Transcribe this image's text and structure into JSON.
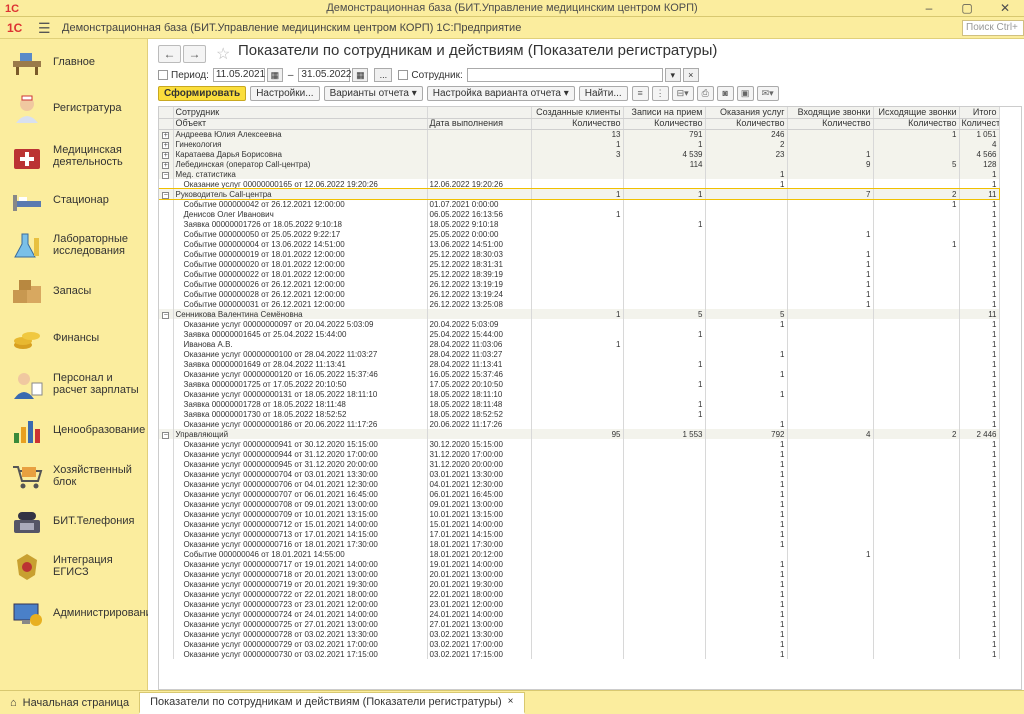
{
  "window": {
    "title": "Демонстрационная база (БИТ.Управление медицинским центром КОРП)",
    "logo": "1С"
  },
  "appbar": {
    "app_title": "Демонстрационная база (БИТ.Управление медицинским центром КОРП)  1С:Предприятие",
    "search_placeholder": "Поиск Ctrl+"
  },
  "sidebar": {
    "items": [
      {
        "label": "Главное",
        "icon": "desk-icon"
      },
      {
        "label": "Регистратура",
        "icon": "nurse-icon"
      },
      {
        "label": "Медицинская деятельность",
        "icon": "medkit-icon"
      },
      {
        "label": "Стационар",
        "icon": "bed-icon"
      },
      {
        "label": "Лабораторные исследования",
        "icon": "lab-icon"
      },
      {
        "label": "Запасы",
        "icon": "boxes-icon"
      },
      {
        "label": "Финансы",
        "icon": "coins-icon"
      },
      {
        "label": "Персонал и расчет зарплаты",
        "icon": "staff-icon"
      },
      {
        "label": "Ценообразование",
        "icon": "chart-icon"
      },
      {
        "label": "Хозяйственный блок",
        "icon": "cart-icon"
      },
      {
        "label": "БИТ.Телефония",
        "icon": "phone-icon"
      },
      {
        "label": "Интеграция ЕГИСЗ",
        "icon": "emblem-icon"
      },
      {
        "label": "Администрирование",
        "icon": "admin-icon"
      }
    ]
  },
  "page": {
    "title": "Показатели по сотрудникам и действиям (Показатели регистратуры)"
  },
  "filters": {
    "period_label": "Период:",
    "date_from": "11.05.2021",
    "dash": "–",
    "date_to": "31.05.2022",
    "ellipsis": "...",
    "employee_label": "Сотрудник:",
    "employee_value": ""
  },
  "toolbar": {
    "generate": "Сформировать",
    "settings": "Настройки...",
    "variants": "Варианты отчета",
    "variant_settings": "Настройка варианта отчета",
    "find": "Найти..."
  },
  "table": {
    "headers1": [
      "Сотрудник",
      "",
      "Созданные клиенты",
      "Записи на прием",
      "Оказания услуг",
      "Входящие звонки",
      "Исходящие звонки",
      "Итого"
    ],
    "headers2": [
      "Объект",
      "Дата выполнения",
      "Количество",
      "Количество",
      "Количество",
      "Количество",
      "Количество",
      "Количество"
    ],
    "rows": [
      {
        "t": "g",
        "c": [
          "Андреева Юлия Алексеевна",
          "",
          "13",
          "791",
          "246",
          "",
          "1",
          "1 051"
        ]
      },
      {
        "t": "g",
        "c": [
          "Гинекология",
          "",
          "1",
          "1",
          "2",
          "",
          "",
          "4"
        ]
      },
      {
        "t": "g",
        "c": [
          "Каратаева Дарья Борисовна",
          "",
          "3",
          "4 539",
          "23",
          "1",
          "",
          "4 566"
        ]
      },
      {
        "t": "g",
        "c": [
          "Лебединская (оператор Call-центра)",
          "",
          "",
          "114",
          "",
          "9",
          "5",
          "128"
        ]
      },
      {
        "t": "g",
        "o": 1,
        "c": [
          "Мед. статистика",
          "",
          "",
          "",
          "1",
          "",
          "",
          "1"
        ]
      },
      {
        "t": "d",
        "c": [
          "Оказание услуг 00000000165 от 12.06.2022 19:20:26",
          "12.06.2022 19:20:26",
          "",
          "",
          "1",
          "",
          "",
          "1"
        ]
      },
      {
        "t": "g",
        "o": 1,
        "s": 1,
        "c": [
          "Руководитель Call-центра",
          "",
          "1",
          "1",
          "",
          "7",
          "2",
          "11"
        ]
      },
      {
        "t": "d",
        "c": [
          "Событие 000000042 от 26.12.2021 12:00:00",
          "01.07.2021 0:00:00",
          "",
          "",
          "",
          "",
          "1",
          "1"
        ]
      },
      {
        "t": "d",
        "c": [
          "Денисов Олег Иванович",
          "06.05.2022 16:13:56",
          "1",
          "",
          "",
          "",
          "",
          "1"
        ]
      },
      {
        "t": "d",
        "c": [
          "Заявка 00000001726 от 18.05.2022 9:10:18",
          "18.05.2022 9:10:18",
          "",
          "1",
          "",
          "",
          "",
          "1"
        ]
      },
      {
        "t": "d",
        "c": [
          "Событие 000000050 от 25.05.2022 9:22:17",
          "25.05.2022 0:00:00",
          "",
          "",
          "",
          "1",
          "",
          "1"
        ]
      },
      {
        "t": "d",
        "c": [
          "Событие 000000004 от 13.06.2022 14:51:00",
          "13.06.2022 14:51:00",
          "",
          "",
          "",
          "",
          "1",
          "1"
        ]
      },
      {
        "t": "d",
        "c": [
          "Событие 000000019 от 18.01.2022 12:00:00",
          "25.12.2022 18:30:03",
          "",
          "",
          "",
          "1",
          "",
          "1"
        ]
      },
      {
        "t": "d",
        "c": [
          "Событие 000000020 от 18.01.2022 12:00:00",
          "25.12.2022 18:31:31",
          "",
          "",
          "",
          "1",
          "",
          "1"
        ]
      },
      {
        "t": "d",
        "c": [
          "Событие 000000022 от 18.01.2022 12:00:00",
          "25.12.2022 18:39:19",
          "",
          "",
          "",
          "1",
          "",
          "1"
        ]
      },
      {
        "t": "d",
        "c": [
          "Событие 000000026 от 26.12.2021 12:00:00",
          "26.12.2022 13:19:19",
          "",
          "",
          "",
          "1",
          "",
          "1"
        ]
      },
      {
        "t": "d",
        "c": [
          "Событие 000000028 от 26.12.2021 12:00:00",
          "26.12.2022 13:19:24",
          "",
          "",
          "",
          "1",
          "",
          "1"
        ]
      },
      {
        "t": "d",
        "c": [
          "Событие 000000031 от 26.12.2021 12:00:00",
          "26.12.2022 13:25:08",
          "",
          "",
          "",
          "1",
          "",
          "1"
        ]
      },
      {
        "t": "g",
        "o": 1,
        "c": [
          "Сенникова Валентина Семёновна",
          "",
          "1",
          "5",
          "5",
          "",
          "",
          "11"
        ]
      },
      {
        "t": "d",
        "c": [
          "Оказание услуг 00000000097 от 20.04.2022 5:03:09",
          "20.04.2022 5:03:09",
          "",
          "",
          "1",
          "",
          "",
          "1"
        ]
      },
      {
        "t": "d",
        "c": [
          "Заявка 00000001645 от 25.04.2022 15:44:00",
          "25.04.2022 15:44:00",
          "",
          "1",
          "",
          "",
          "",
          "1"
        ]
      },
      {
        "t": "d",
        "c": [
          "Иванова А.В.",
          "28.04.2022 11:03:06",
          "1",
          "",
          "",
          "",
          "",
          "1"
        ]
      },
      {
        "t": "d",
        "c": [
          "Оказание услуг 00000000100 от 28.04.2022 11:03:27",
          "28.04.2022 11:03:27",
          "",
          "",
          "1",
          "",
          "",
          "1"
        ]
      },
      {
        "t": "d",
        "c": [
          "Заявка 00000001649 от 28.04.2022 11:13:41",
          "28.04.2022 11:13:41",
          "",
          "1",
          "",
          "",
          "",
          "1"
        ]
      },
      {
        "t": "d",
        "c": [
          "Оказание услуг 00000000120 от 16.05.2022 15:37:46",
          "16.05.2022 15:37:46",
          "",
          "",
          "1",
          "",
          "",
          "1"
        ]
      },
      {
        "t": "d",
        "c": [
          "Заявка 00000001725 от 17.05.2022 20:10:50",
          "17.05.2022 20:10:50",
          "",
          "1",
          "",
          "",
          "",
          "1"
        ]
      },
      {
        "t": "d",
        "c": [
          "Оказание услуг 00000000131 от 18.05.2022 18:11:10",
          "18.05.2022 18:11:10",
          "",
          "",
          "1",
          "",
          "",
          "1"
        ]
      },
      {
        "t": "d",
        "c": [
          "Заявка 00000001728 от 18.05.2022 18:11:48",
          "18.05.2022 18:11:48",
          "",
          "1",
          "",
          "",
          "",
          "1"
        ]
      },
      {
        "t": "d",
        "c": [
          "Заявка 00000001730 от 18.05.2022 18:52:52",
          "18.05.2022 18:52:52",
          "",
          "1",
          "",
          "",
          "",
          "1"
        ]
      },
      {
        "t": "d",
        "c": [
          "Оказание услуг 00000000186 от 20.06.2022 11:17:26",
          "20.06.2022 11:17:26",
          "",
          "",
          "1",
          "",
          "",
          "1"
        ]
      },
      {
        "t": "g",
        "o": 1,
        "c": [
          "Управляющий",
          "",
          "95",
          "1 553",
          "792",
          "4",
          "2",
          "2 446"
        ]
      },
      {
        "t": "d",
        "c": [
          "Оказание услуг 00000000941 от 30.12.2020 15:15:00",
          "30.12.2020 15:15:00",
          "",
          "",
          "1",
          "",
          "",
          "1"
        ]
      },
      {
        "t": "d",
        "c": [
          "Оказание услуг 00000000944 от 31.12.2020 17:00:00",
          "31.12.2020 17:00:00",
          "",
          "",
          "1",
          "",
          "",
          "1"
        ]
      },
      {
        "t": "d",
        "c": [
          "Оказание услуг 00000000945 от 31.12.2020 20:00:00",
          "31.12.2020 20:00:00",
          "",
          "",
          "1",
          "",
          "",
          "1"
        ]
      },
      {
        "t": "d",
        "c": [
          "Оказание услуг 00000000704 от 03.01.2021 13:30:00",
          "03.01.2021 13:30:00",
          "",
          "",
          "1",
          "",
          "",
          "1"
        ]
      },
      {
        "t": "d",
        "c": [
          "Оказание услуг 00000000706 от 04.01.2021 12:30:00",
          "04.01.2021 12:30:00",
          "",
          "",
          "1",
          "",
          "",
          "1"
        ]
      },
      {
        "t": "d",
        "c": [
          "Оказание услуг 00000000707 от 06.01.2021 16:45:00",
          "06.01.2021 16:45:00",
          "",
          "",
          "1",
          "",
          "",
          "1"
        ]
      },
      {
        "t": "d",
        "c": [
          "Оказание услуг 00000000708 от 09.01.2021 13:00:00",
          "09.01.2021 13:00:00",
          "",
          "",
          "1",
          "",
          "",
          "1"
        ]
      },
      {
        "t": "d",
        "c": [
          "Оказание услуг 00000000709 от 10.01.2021 13:15:00",
          "10.01.2021 13:15:00",
          "",
          "",
          "1",
          "",
          "",
          "1"
        ]
      },
      {
        "t": "d",
        "c": [
          "Оказание услуг 00000000712 от 15.01.2021 14:00:00",
          "15.01.2021 14:00:00",
          "",
          "",
          "1",
          "",
          "",
          "1"
        ]
      },
      {
        "t": "d",
        "c": [
          "Оказание услуг 00000000713 от 17.01.2021 14:15:00",
          "17.01.2021 14:15:00",
          "",
          "",
          "1",
          "",
          "",
          "1"
        ]
      },
      {
        "t": "d",
        "c": [
          "Оказание услуг 00000000716 от 18.01.2021 17:30:00",
          "18.01.2021 17:30:00",
          "",
          "",
          "1",
          "",
          "",
          "1"
        ]
      },
      {
        "t": "d",
        "c": [
          "Событие 000000046 от 18.01.2021 14:55:00",
          "18.01.2021 20:12:00",
          "",
          "",
          "",
          "1",
          "",
          "1"
        ]
      },
      {
        "t": "d",
        "c": [
          "Оказание услуг 00000000717 от 19.01.2021 14:00:00",
          "19.01.2021 14:00:00",
          "",
          "",
          "1",
          "",
          "",
          "1"
        ]
      },
      {
        "t": "d",
        "c": [
          "Оказание услуг 00000000718 от 20.01.2021 13:00:00",
          "20.01.2021 13:00:00",
          "",
          "",
          "1",
          "",
          "",
          "1"
        ]
      },
      {
        "t": "d",
        "c": [
          "Оказание услуг 00000000719 от 20.01.2021 19:30:00",
          "20.01.2021 19:30:00",
          "",
          "",
          "1",
          "",
          "",
          "1"
        ]
      },
      {
        "t": "d",
        "c": [
          "Оказание услуг 00000000722 от 22.01.2021 18:00:00",
          "22.01.2021 18:00:00",
          "",
          "",
          "1",
          "",
          "",
          "1"
        ]
      },
      {
        "t": "d",
        "c": [
          "Оказание услуг 00000000723 от 23.01.2021 12:00:00",
          "23.01.2021 12:00:00",
          "",
          "",
          "1",
          "",
          "",
          "1"
        ]
      },
      {
        "t": "d",
        "c": [
          "Оказание услуг 00000000724 от 24.01.2021 14:00:00",
          "24.01.2021 14:00:00",
          "",
          "",
          "1",
          "",
          "",
          "1"
        ]
      },
      {
        "t": "d",
        "c": [
          "Оказание услуг 00000000725 от 27.01.2021 13:00:00",
          "27.01.2021 13:00:00",
          "",
          "",
          "1",
          "",
          "",
          "1"
        ]
      },
      {
        "t": "d",
        "c": [
          "Оказание услуг 00000000728 от 03.02.2021 13:30:00",
          "03.02.2021 13:30:00",
          "",
          "",
          "1",
          "",
          "",
          "1"
        ]
      },
      {
        "t": "d",
        "c": [
          "Оказание услуг 00000000729 от 03.02.2021 17:00:00",
          "03.02.2021 17:00:00",
          "",
          "",
          "1",
          "",
          "",
          "1"
        ]
      },
      {
        "t": "d",
        "c": [
          "Оказание услуг 00000000730 от 03.02.2021 17:15:00",
          "03.02.2021 17:15:00",
          "",
          "",
          "1",
          "",
          "",
          "1"
        ]
      }
    ]
  },
  "tabs": [
    {
      "label": "Начальная страница",
      "icon": "home-icon"
    },
    {
      "label": "Показатели по сотрудникам и действиям (Показатели регистратуры)",
      "close": "×"
    }
  ]
}
